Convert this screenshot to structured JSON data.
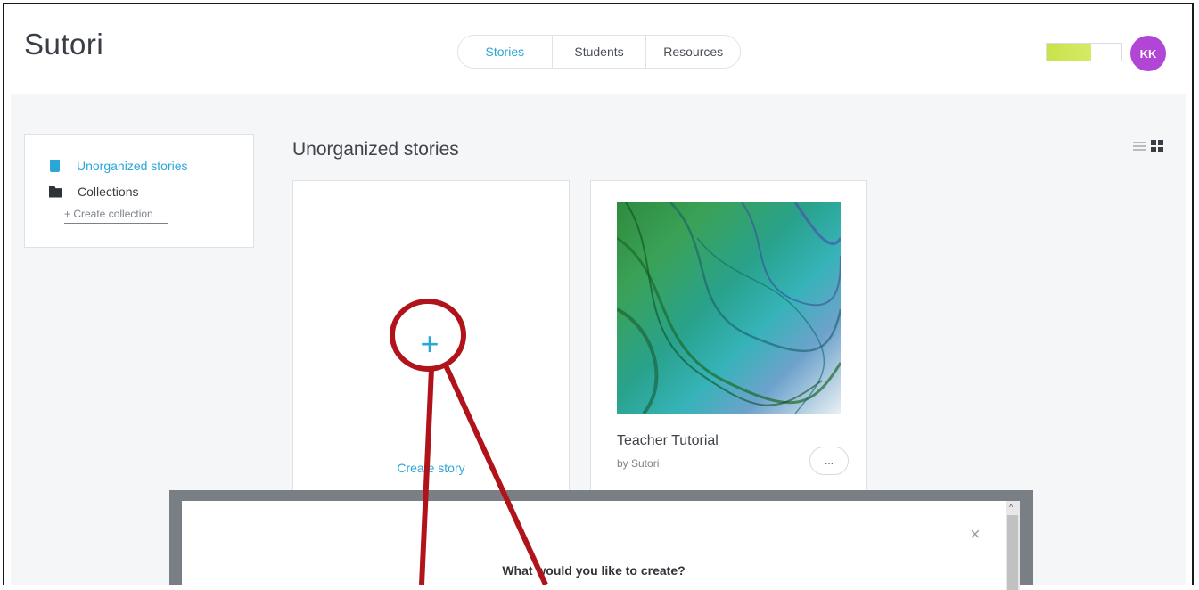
{
  "app": {
    "logo": "Sutori"
  },
  "nav": {
    "tabs": [
      {
        "label": "Stories",
        "active": true
      },
      {
        "label": "Students",
        "active": false
      },
      {
        "label": "Resources",
        "active": false
      }
    ]
  },
  "user": {
    "initials": "KK",
    "avatar_color": "#b145d6",
    "storage_fill_percent": 60
  },
  "sidebar": {
    "items": [
      {
        "label": "Unorganized stories",
        "icon": "book-icon",
        "active": true
      },
      {
        "label": "Collections",
        "icon": "folder-icon",
        "active": false
      }
    ],
    "create_collection_label": "+ Create collection"
  },
  "main": {
    "title": "Unorganized stories",
    "create_card": {
      "plus": "+",
      "label": "Create story"
    },
    "story_card": {
      "title": "Teacher Tutorial",
      "author": "by Sutori",
      "more_label": "..."
    }
  },
  "modal": {
    "title": "What would you like to create?",
    "close": "×",
    "scroll_up": "^"
  },
  "colors": {
    "accent": "#2aa7d8",
    "annotation": "#b0141a",
    "progress": "#c7e34a"
  }
}
